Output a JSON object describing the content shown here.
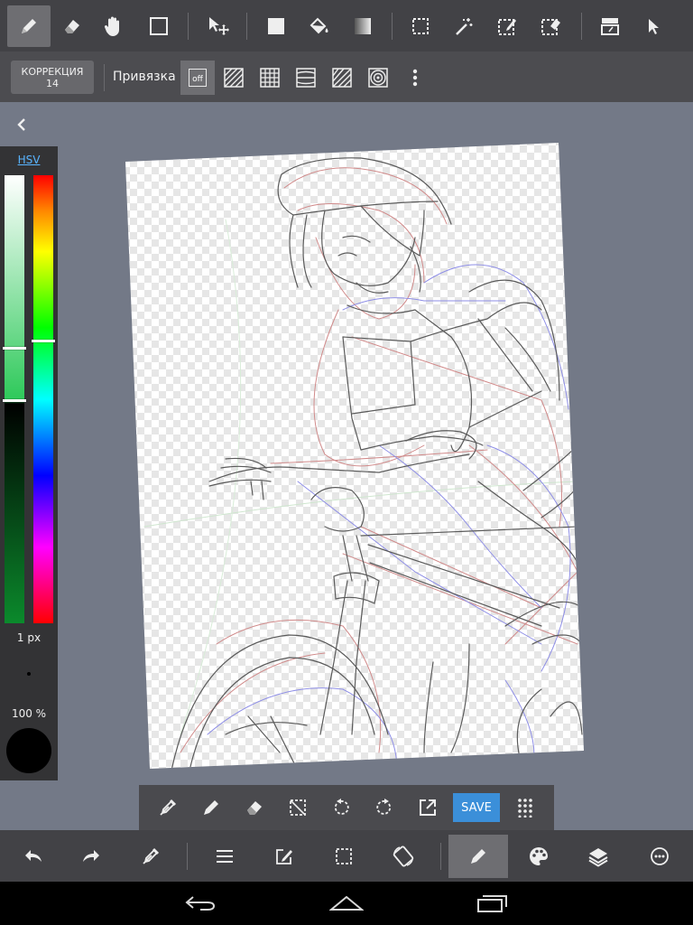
{
  "toolbar_top": {
    "tools": [
      {
        "icon": "pen-icon",
        "active": true
      },
      {
        "icon": "eraser-icon"
      },
      {
        "icon": "hand-icon"
      },
      {
        "icon": "rectangle-outline-icon"
      },
      {
        "icon": "move-icon"
      },
      {
        "icon": "filled-square-icon"
      },
      {
        "icon": "bucket-fill-icon"
      },
      {
        "icon": "gradient-icon"
      },
      {
        "icon": "select-rect-icon"
      },
      {
        "icon": "magic-wand-icon"
      },
      {
        "icon": "select-pen-icon"
      },
      {
        "icon": "select-eraser-icon"
      },
      {
        "icon": "layer-text-icon"
      },
      {
        "icon": "cursor-icon"
      }
    ]
  },
  "snap_bar": {
    "correction_label": "КОРРЕКЦИЯ",
    "correction_value": "14",
    "snap_label": "Привязка",
    "off_label": "off",
    "options": [
      "snap-off-icon",
      "snap-parallel-icon",
      "snap-grid-icon",
      "snap-perspective-icon",
      "snap-diagonal-icon",
      "snap-concentric-icon",
      "more-icon"
    ]
  },
  "color_panel": {
    "mode": "HSV",
    "brush_size": "1 px",
    "opacity": "100 %",
    "current_color": "#000000",
    "hue_level": 0.38,
    "value_level": 0.39
  },
  "tool_strip": {
    "save_label": "SAVE",
    "icons": [
      "eyedropper-icon",
      "pen-icon",
      "eraser-icon",
      "deselect-icon",
      "rotate-left-icon",
      "rotate-right-icon",
      "export-icon",
      "save-button",
      "grid-menu-icon"
    ]
  },
  "bottom_bar": {
    "icons": [
      "undo-icon",
      "redo-icon",
      "eyedropper-icon",
      "menu-icon",
      "edit-icon",
      "selection-icon",
      "transform-icon",
      "brush-icon",
      "palette-icon",
      "layers-icon",
      "settings-icon"
    ],
    "active": "brush-icon"
  },
  "colors": {
    "accent": "#3b8fd9",
    "toolbar": "#424246",
    "background": "#737987"
  }
}
